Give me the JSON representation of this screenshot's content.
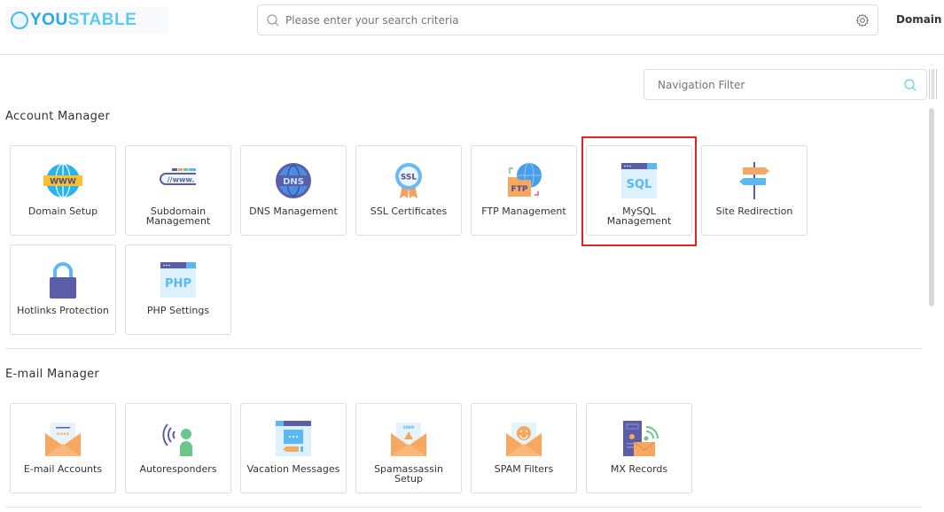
{
  "header": {
    "logo_text_1": "YOU",
    "logo_text_2": "STABLE",
    "search_placeholder": "Please enter your search criteria",
    "domain_label": "Domain"
  },
  "nav_filter": {
    "placeholder": "Navigation Filter"
  },
  "sections": [
    {
      "title": "Account Manager",
      "items": [
        {
          "label": "Domain Setup",
          "icon": "www-globe-icon"
        },
        {
          "label": "Subdomain Management",
          "icon": "subdomain-icon"
        },
        {
          "label": "DNS Management",
          "icon": "dns-globe-icon"
        },
        {
          "label": "SSL Certificates",
          "icon": "ssl-badge-icon"
        },
        {
          "label": "FTP Management",
          "icon": "ftp-folder-icon"
        },
        {
          "label": "MySQL Management",
          "icon": "sql-window-icon",
          "highlighted": true
        },
        {
          "label": "Site Redirection",
          "icon": "signpost-icon"
        },
        {
          "label": "Hotlinks Protection",
          "icon": "padlock-icon"
        },
        {
          "label": "PHP Settings",
          "icon": "php-window-icon"
        }
      ]
    },
    {
      "title": "E-mail Manager",
      "items": [
        {
          "label": "E-mail Accounts",
          "icon": "email-accounts-icon"
        },
        {
          "label": "Autoresponders",
          "icon": "autoresponder-icon"
        },
        {
          "label": "Vacation Messages",
          "icon": "vacation-message-icon"
        },
        {
          "label": "Spamassassin Setup",
          "icon": "spam-envelope-icon"
        },
        {
          "label": "SPAM Filters",
          "icon": "smiley-envelope-icon"
        },
        {
          "label": "MX Records",
          "icon": "mx-server-icon"
        }
      ]
    }
  ],
  "icon_text": {
    "www": "WWW",
    "dns": "DNS",
    "ssl": "SSL",
    "ftp": "FTP",
    "sql": "SQL",
    "php": "PHP",
    "subdomain": "//www.",
    "spam": "SPAM"
  },
  "colors": {
    "highlight": "#e2232a",
    "accent": "#2aa8e0"
  }
}
